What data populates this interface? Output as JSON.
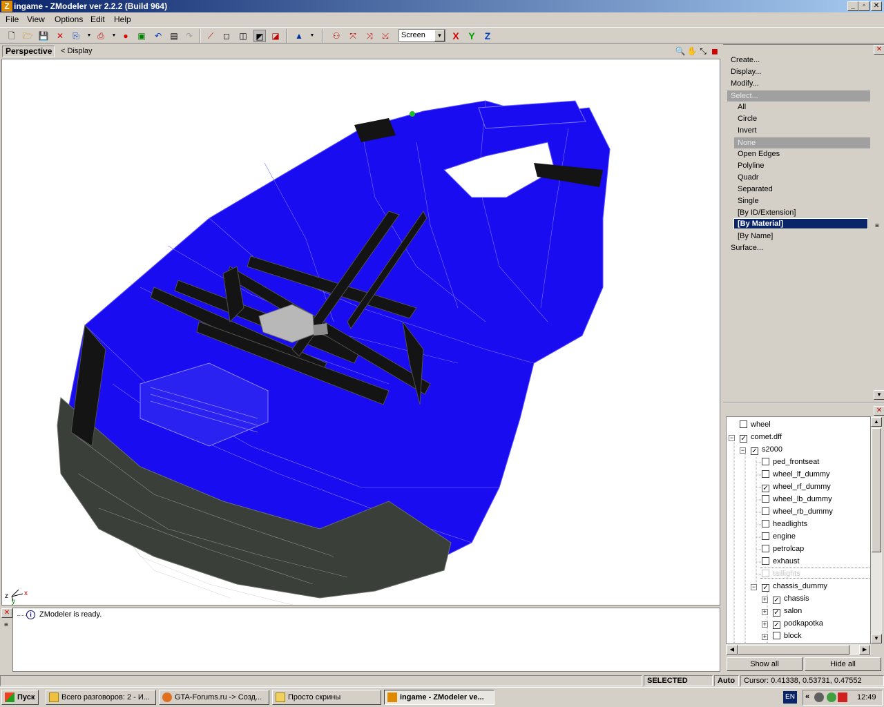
{
  "window": {
    "title": "ingame - ZModeler ver 2.2.2 (Build 964)",
    "min": "_",
    "max": "▫",
    "close": "✕"
  },
  "menu": [
    "File",
    "View",
    "Options",
    "Edit",
    "Help"
  ],
  "toolbar": {
    "view_mode": "Screen",
    "axis_x": "X",
    "axis_y": "Y",
    "axis_z": "Z"
  },
  "viewport": {
    "tab": "Perspective",
    "display_label": "< Display",
    "axis_x": "x",
    "axis_y": "y",
    "axis_z": "z"
  },
  "panel": {
    "items": [
      "Create...",
      "Display...",
      "Modify..."
    ],
    "select_header": "Select...",
    "select_items": [
      "All",
      "Circle",
      "Invert",
      "None",
      "Open Edges",
      "Polyline",
      "Quadr",
      "Separated",
      "Single",
      "[By ID/Extension]",
      "[By Material]",
      "[By Name]"
    ],
    "surface": "Surface..."
  },
  "tree": {
    "nodes": [
      {
        "label": "wheel",
        "checked": false
      },
      {
        "label": "comet.dff",
        "checked": true
      },
      {
        "label": "s2000",
        "checked": true
      },
      {
        "label": "ped_frontseat",
        "checked": false
      },
      {
        "label": "wheel_lf_dummy",
        "checked": false
      },
      {
        "label": "wheel_rf_dummy",
        "checked": true
      },
      {
        "label": "wheel_lb_dummy",
        "checked": false
      },
      {
        "label": "wheel_rb_dummy",
        "checked": false
      },
      {
        "label": "headlights",
        "checked": false
      },
      {
        "label": "engine",
        "checked": false
      },
      {
        "label": "petrolcap",
        "checked": false
      },
      {
        "label": "exhaust",
        "checked": false
      },
      {
        "label": "taillights",
        "checked": false
      },
      {
        "label": "chassis_dummy",
        "checked": true
      },
      {
        "label": "chassis",
        "checked": true
      },
      {
        "label": "salon",
        "checked": true
      },
      {
        "label": "podkapotka",
        "checked": true
      },
      {
        "label": "block",
        "checked": false
      }
    ],
    "show_all": "Show all",
    "hide_all": "Hide all"
  },
  "log": {
    "message": "ZModeler is ready."
  },
  "status": {
    "mode": "SELECTED MODE",
    "auto": "Auto",
    "cursor": "Cursor: 0.41338, 0.53731, 0.47552"
  },
  "taskbar": {
    "start": "Пуск",
    "tasks": [
      "Всего разговоров: 2 - И...",
      "GTA-Forums.ru -> Созд...",
      "Просто скрины",
      "ingame - ZModeler ve..."
    ],
    "lang": "EN",
    "clock": "12:49"
  },
  "colors": {
    "body_blue": "#1a0cf0",
    "frame_black": "#141414",
    "titlebar": "#0a246a"
  }
}
